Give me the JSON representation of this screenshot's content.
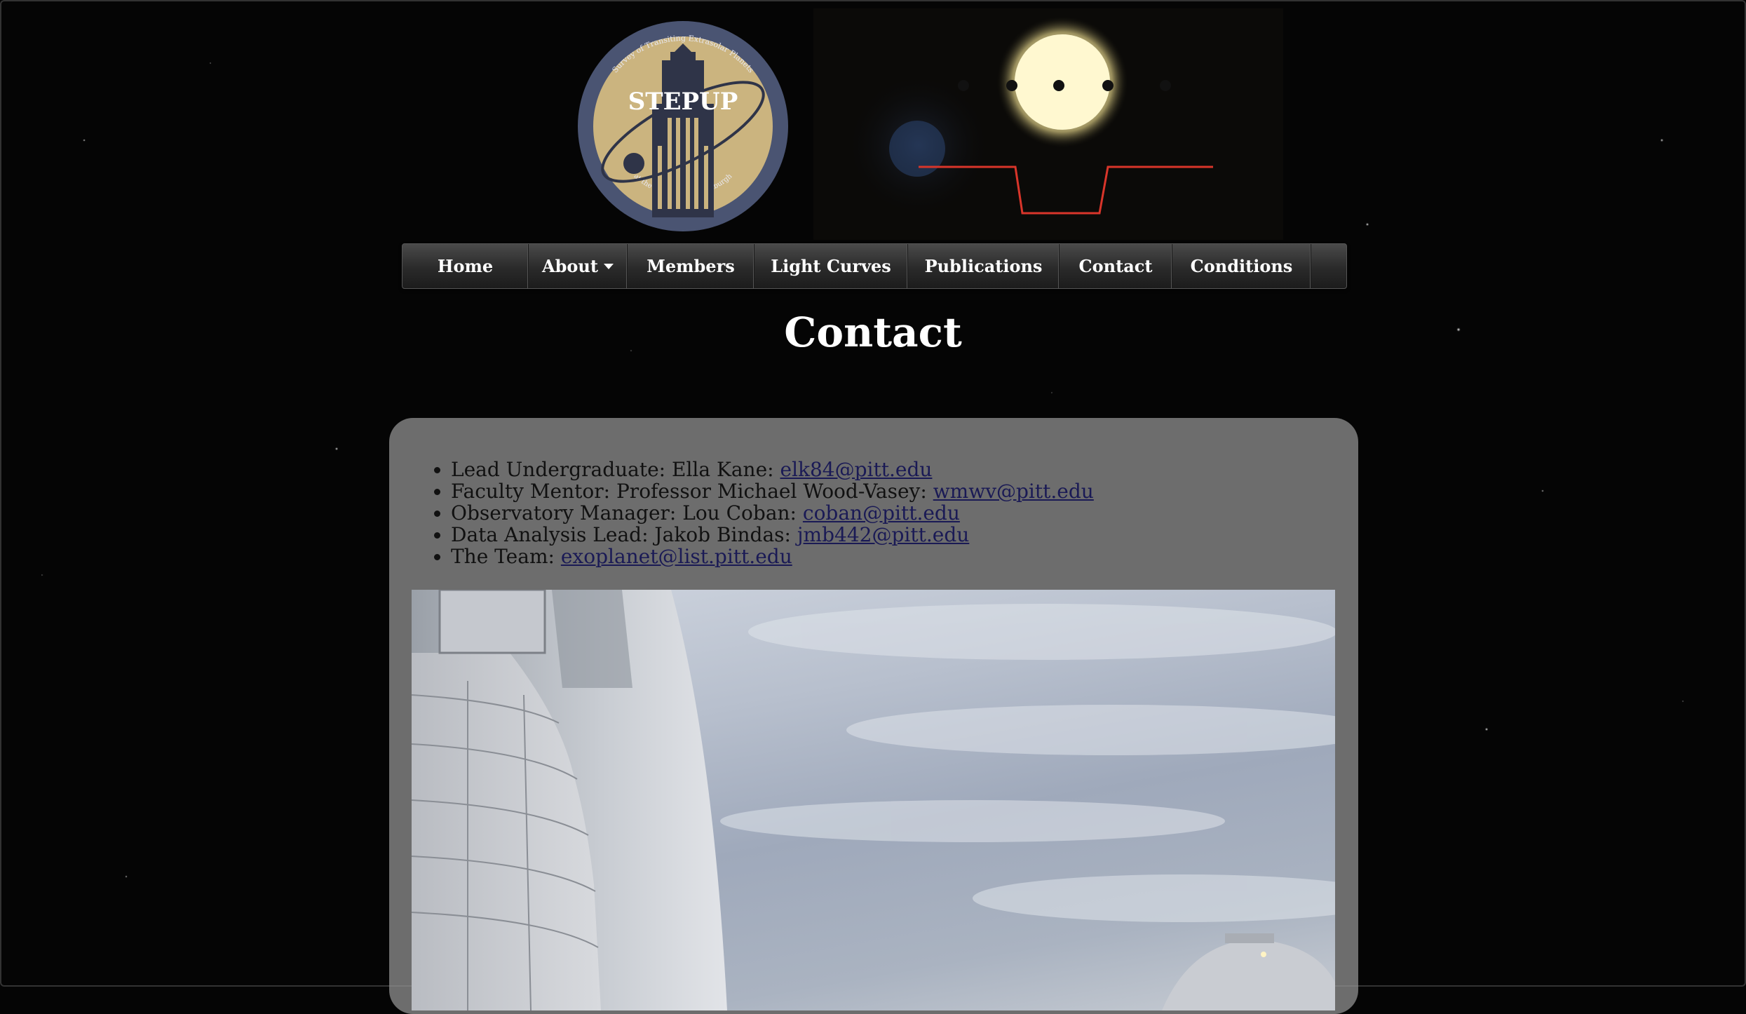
{
  "logo": {
    "name": "STEPUP",
    "ring_top": "Survey of Transiting Extrasolar Planets",
    "ring_bottom": "at the University of Pittsburgh"
  },
  "nav": {
    "items": [
      {
        "label": "Home"
      },
      {
        "label": "About",
        "has_dropdown": true
      },
      {
        "label": "Members"
      },
      {
        "label": "Light Curves"
      },
      {
        "label": "Publications"
      },
      {
        "label": "Contact"
      },
      {
        "label": "Conditions"
      }
    ]
  },
  "page": {
    "title": "Contact"
  },
  "contacts": [
    {
      "role": "Lead Undergraduate: Ella Kane: ",
      "email": "elk84@pitt.edu"
    },
    {
      "role": "Faculty Mentor: Professor Michael Wood-Vasey: ",
      "email": "wmwv@pitt.edu"
    },
    {
      "role": "Observatory Manager: Lou Coban: ",
      "email": "coban@pitt.edu"
    },
    {
      "role": "Data Analysis Lead: Jakob Bindas: ",
      "email": "jmb442@pitt.edu"
    },
    {
      "role": "The Team: ",
      "email": "exoplanet@list.pitt.edu"
    }
  ],
  "colors": {
    "link": "#1a1a55",
    "logo_gold": "#cbb47f",
    "logo_ring": "#4a5472",
    "transit_line": "#d9352a"
  }
}
